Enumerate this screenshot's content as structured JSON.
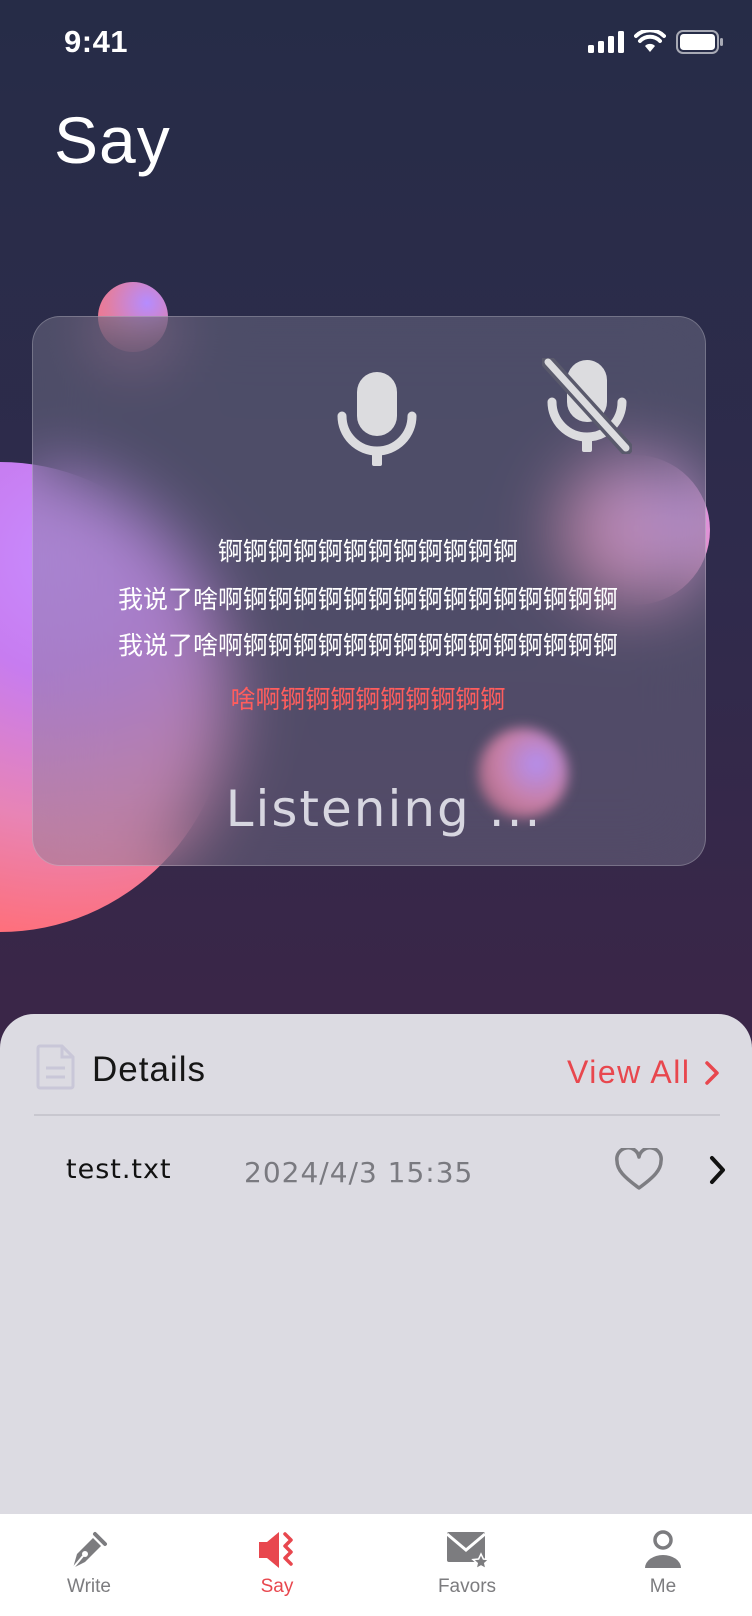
{
  "status_bar": {
    "time": "9:41"
  },
  "page": {
    "title": "Say"
  },
  "voice_card": {
    "mic_icon": "microphone-icon",
    "mic_off_icon": "microphone-off-icon",
    "transcript_lines": [
      "锕锕锕锕锕锕锕锕锕锕锕锕",
      "我说了啥啊锕锕锕锕锕锕锕锕锕锕锕锕锕锕锕",
      "我说了啥啊锕锕锕锕锕锕锕锕锕锕锕锕锕锕锕",
      "啥啊锕锕锕锕锕锕锕锕锕"
    ],
    "status": "Listening ...",
    "highlight_color": "#ff5d5d"
  },
  "details": {
    "label": "Details",
    "view_all": "View All",
    "items": [
      {
        "name": "test.txt",
        "date": "2024/4/3 15:35"
      }
    ]
  },
  "tabbar": {
    "tabs": [
      {
        "label": "Write",
        "icon": "pen-icon"
      },
      {
        "label": "Say",
        "icon": "speaker-icon"
      },
      {
        "label": "Favors",
        "icon": "mail-star-icon"
      },
      {
        "label": "Me",
        "icon": "person-icon"
      }
    ],
    "active_color": "#e8474e"
  }
}
